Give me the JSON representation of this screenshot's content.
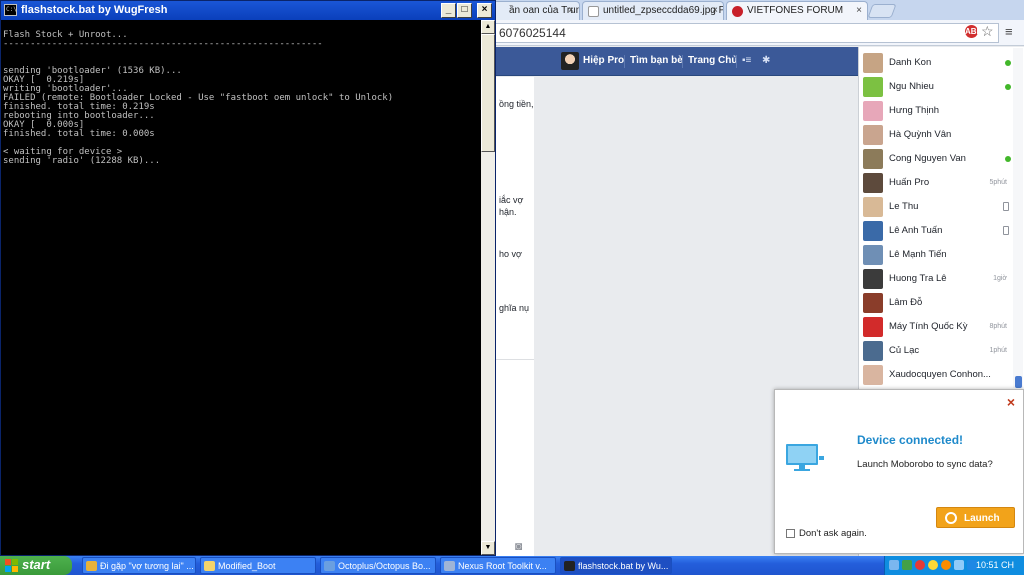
{
  "browser": {
    "tabs": [
      {
        "label": "ần oan của Trung",
        "close": "×"
      },
      {
        "label": "untitled_zpseccdda69.jpg Ph",
        "close": "×"
      },
      {
        "label": "VIETFONES FORUM",
        "close": "×"
      }
    ],
    "url_fragment": "6076025144",
    "badge_text": "ABP",
    "facebook": {
      "user_name": "Hiệp Pro",
      "find_friends": "Tìm bạn bè",
      "home": "Trang Chủ"
    },
    "feed_snippets": [
      "ồng tiền,",
      "iắc vợ",
      "hận.",
      "ho vợ",
      "ghĩa nụ"
    ],
    "chat_contacts": [
      {
        "name": "Danh Kon",
        "status": "online",
        "avatar_color": "#c6a484"
      },
      {
        "name": "Ngu Nhieu",
        "status": "online",
        "avatar_color": "#7cc142"
      },
      {
        "name": "Hưng Thịnh",
        "status": "",
        "avatar_color": "#e7a7b9"
      },
      {
        "name": "Hà Quỳnh Vân",
        "status": "",
        "avatar_color": "#c9a58f"
      },
      {
        "name": "Cong Nguyen Van",
        "status": "online",
        "avatar_color": "#8c7b5a"
      },
      {
        "name": "Huấn Pro",
        "status": "5phút",
        "avatar_color": "#5d4a3c"
      },
      {
        "name": "Le Thu",
        "status": "mobile",
        "avatar_color": "#d8b996"
      },
      {
        "name": "Lê Anh Tuấn",
        "status": "mobile",
        "avatar_color": "#3a6aa8"
      },
      {
        "name": "Lê Mạnh Tiến",
        "status": "",
        "avatar_color": "#6f8fb5"
      },
      {
        "name": "Huong Tra Lê",
        "status": "1giờ",
        "avatar_color": "#3b3b3b"
      },
      {
        "name": "Lâm Đỗ",
        "status": "",
        "avatar_color": "#8a3d2a"
      },
      {
        "name": "Máy Tính Quốc Kỳ",
        "status": "8phút",
        "avatar_color": "#d22b2b"
      },
      {
        "name": "Củ Lạc",
        "status": "1phút",
        "avatar_color": "#4b6b8f"
      },
      {
        "name": "Xaudocquyen Conhon...",
        "status": "",
        "avatar_color": "#d9b5a0"
      }
    ]
  },
  "console": {
    "title": "flashstock.bat by WugFresh",
    "icon_text": "C:\\",
    "controls": {
      "minimize": "_",
      "maximize": "□",
      "close": "×"
    },
    "scroll": {
      "up": "▲",
      "down": "▼"
    },
    "lines": [
      "Flash Stock + Unroot...",
      "-----------------------------------------------------------",
      "",
      "",
      "sending 'bootloader' (1536 KB)...",
      "OKAY [  0.219s]",
      "writing 'bootloader'...",
      "FAILED (remote: Bootloader Locked - Use \"fastboot oem unlock\" to Unlock)",
      "finished. total time: 0.219s",
      "rebooting into bootloader...",
      "OKAY [  0.000s]",
      "finished. total time: 0.000s",
      "",
      "< waiting for device >",
      "sending 'radio' (12288 KB)..."
    ]
  },
  "popup": {
    "close": "×",
    "title": "Device connected!",
    "subtitle": "Launch Moborobo to sync data?",
    "launch_label": "Launch",
    "checkbox_label": "Don't ask again."
  },
  "taskbar": {
    "start_label": "start",
    "items": [
      {
        "label": "Đi gặp \"vợ tương lai\" ...",
        "icon_color": "#e8b23a"
      },
      {
        "label": "Modified_Boot",
        "icon_color": "#f3d46b"
      },
      {
        "label": "Octoplus/Octopus Bo...",
        "icon_color": "#6a9fe0"
      },
      {
        "label": "Nexus Root Toolkit v...",
        "icon_color": "#9fb4d6"
      },
      {
        "label": "flashstock.bat by Wu...",
        "icon_color": "#222222"
      }
    ],
    "clock": "10:51 CH"
  },
  "colors": {
    "facebook_blue": "#3b5998",
    "console_bg": "#000000",
    "console_text": "#c0c0c0",
    "popup_accent": "#1f8acb",
    "launch_orange": "#f2a31a",
    "xp_title": "#0a3fbb",
    "start_green": "#3a9a3a"
  }
}
